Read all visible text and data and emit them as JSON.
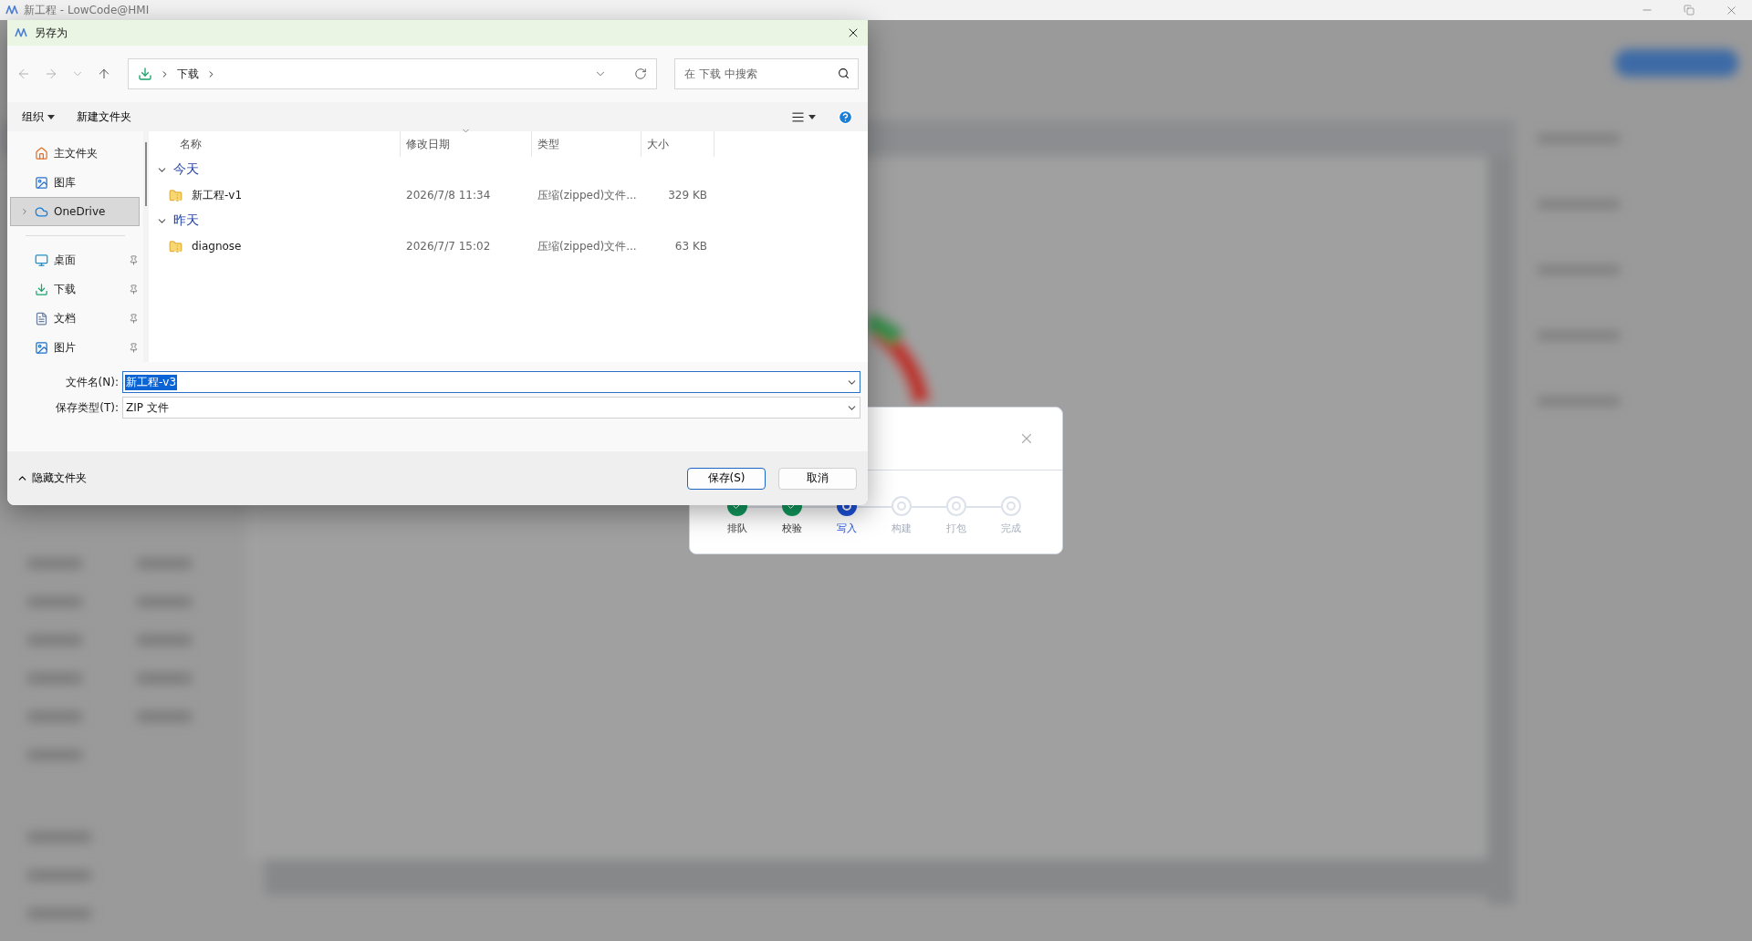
{
  "app_window": {
    "title": "新工程 - LowCode@HMI"
  },
  "save_dialog": {
    "title": "另存为",
    "path": [
      {
        "label": "下载"
      }
    ],
    "search": {
      "placeholder": "在 下载 中搜索"
    },
    "toolbar": {
      "organize": "组织",
      "new_folder": "新建文件夹"
    },
    "nav_items": [
      {
        "label": "主文件夹",
        "kind": "home",
        "selected": false,
        "pinned": false,
        "expandable": false
      },
      {
        "label": "图库",
        "kind": "gallery",
        "selected": false,
        "pinned": false,
        "expandable": false
      },
      {
        "label": "OneDrive",
        "kind": "cloud",
        "selected": true,
        "pinned": false,
        "expandable": true
      },
      {
        "kind": "divider"
      },
      {
        "label": "桌面",
        "kind": "desktop",
        "selected": false,
        "pinned": true,
        "expandable": false
      },
      {
        "label": "下载",
        "kind": "download",
        "selected": false,
        "pinned": true,
        "expandable": false
      },
      {
        "label": "文档",
        "kind": "document",
        "selected": false,
        "pinned": true,
        "expandable": false
      },
      {
        "label": "图片",
        "kind": "picture",
        "selected": false,
        "pinned": true,
        "expandable": false
      }
    ],
    "columns": [
      {
        "label": "名称",
        "sorted": false
      },
      {
        "label": "修改日期",
        "sorted": true
      },
      {
        "label": "类型",
        "sorted": false
      },
      {
        "label": "大小",
        "sorted": false
      }
    ],
    "groups": [
      {
        "label": "今天",
        "expanded": true,
        "files": [
          {
            "name": "新工程-v1",
            "modified": "2026/7/8 11:34",
            "type": "压缩(zipped)文件...",
            "size": "329 KB"
          }
        ]
      },
      {
        "label": "昨天",
        "expanded": true,
        "files": [
          {
            "name": "diagnose",
            "modified": "2026/7/7 15:02",
            "type": "压缩(zipped)文件...",
            "size": "63 KB"
          }
        ]
      }
    ],
    "file_name": {
      "label": "文件名(N):",
      "value": "新工程-v3",
      "selected": true
    },
    "file_type": {
      "label": "保存类型(T):",
      "value": "ZIP 文件"
    },
    "hide_folders": "隐藏文件夹",
    "buttons": [
      {
        "label": "保存(S)",
        "kind": "primary"
      },
      {
        "label": "取消",
        "kind": "secondary"
      }
    ]
  },
  "progress_dialog": {
    "steps": [
      {
        "label": "排队",
        "done": true,
        "active": false
      },
      {
        "label": "校验",
        "done": true,
        "active": false
      },
      {
        "label": "写入",
        "done": false,
        "active": true
      },
      {
        "label": "构建",
        "done": false,
        "active": false
      },
      {
        "label": "打包",
        "done": false,
        "active": false
      },
      {
        "label": "完成",
        "done": false,
        "active": false
      }
    ]
  }
}
